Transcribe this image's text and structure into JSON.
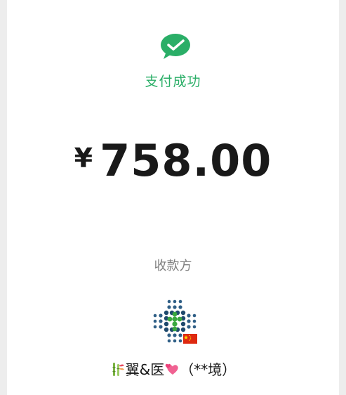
{
  "payment": {
    "status_text": "支付成功",
    "currency_symbol": "¥",
    "amount": "758.00"
  },
  "payee": {
    "label": "收款方",
    "avatar_icon": "pharmacy-cross-logo-icon",
    "name_emoji_before": "bamboo-emoji-icon",
    "name_text": "翼&医",
    "name_emoji_after": "two-hearts-emoji-icon",
    "masked_name": "（**境）"
  },
  "colors": {
    "accent": "#2aae67",
    "text_primary": "#191919",
    "text_secondary": "#7f7f7f",
    "background": "#ededed"
  }
}
